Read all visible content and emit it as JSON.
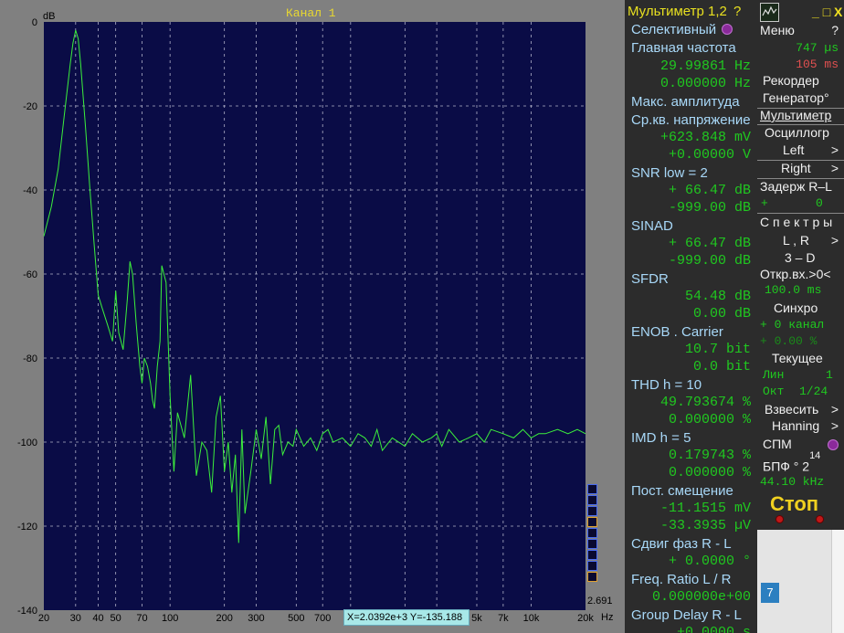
{
  "chart_data": {
    "type": "line",
    "title": "Канал 1",
    "xlabel": "Hz",
    "ylabel": "dB",
    "xscale": "log",
    "xlim": [
      20,
      20000
    ],
    "ylim": [
      -140,
      0
    ],
    "x_ticks": [
      "20",
      "30",
      "40",
      "50",
      "70",
      "100",
      "200",
      "300",
      "500",
      "700",
      "1k",
      "2k",
      "3k",
      "5k",
      "7k",
      "10k",
      "20k"
    ],
    "x_tick_values": [
      20,
      30,
      40,
      50,
      70,
      100,
      200,
      300,
      500,
      700,
      1000,
      2000,
      3000,
      5000,
      7000,
      10000,
      20000
    ],
    "y_ticks": [
      "0",
      "-20",
      "-40",
      "-60",
      "-80",
      "-100",
      "-120",
      "-140"
    ],
    "y_tick_values": [
      0,
      -20,
      -40,
      -60,
      -80,
      -100,
      -120,
      -140
    ],
    "grid": true,
    "series": [
      {
        "x": [
          20,
          22,
          24,
          26,
          28,
          29,
          30,
          31,
          32,
          34,
          36,
          38,
          40,
          42,
          45,
          48,
          50,
          52,
          55,
          58,
          60,
          62,
          65,
          68,
          70,
          72,
          75,
          78,
          80,
          82,
          85,
          88,
          90,
          95,
          100,
          105,
          110,
          120,
          130,
          140,
          150,
          160,
          170,
          180,
          190,
          200,
          210,
          220,
          230,
          240,
          250,
          260,
          280,
          300,
          320,
          340,
          360,
          380,
          400,
          420,
          450,
          480,
          500,
          550,
          600,
          650,
          700,
          750,
          800,
          900,
          1000,
          1100,
          1200,
          1300,
          1400,
          1500,
          1700,
          2000,
          2200,
          2500,
          2800,
          3000,
          3200,
          3500,
          4000,
          4500,
          5000,
          5500,
          6000,
          7000,
          8000,
          9000,
          10000,
          11000,
          12000,
          14000,
          16000,
          18000,
          20000
        ],
        "y": [
          -51,
          -44,
          -35,
          -22,
          -10,
          -5,
          -2,
          -4,
          -10,
          -25,
          -40,
          -53,
          -65,
          -68,
          -72,
          -76,
          -64,
          -74,
          -78,
          -66,
          -57,
          -60,
          -72,
          -82,
          -86,
          -80,
          -82,
          -86,
          -90,
          -92,
          -82,
          -76,
          -58,
          -62,
          -89,
          -107,
          -93,
          -99,
          -84,
          -108,
          -100,
          -102,
          -112,
          -94,
          -89,
          -107,
          -100,
          -112,
          -103,
          -124,
          -97,
          -117,
          -107,
          -97,
          -104,
          -94,
          -110,
          -97,
          -96,
          -103,
          -100,
          -101,
          -97,
          -101,
          -99,
          -102,
          -98,
          -97,
          -100,
          -99,
          -101,
          -98,
          -99,
          -101,
          -97,
          -102,
          -99,
          -101,
          -98,
          -100,
          -99,
          -98,
          -101,
          -97,
          -100,
          -99,
          -98,
          -100,
          -97,
          -98,
          -99,
          -97,
          -99,
          -98,
          -98,
          -97,
          -98,
          -97,
          -98
        ]
      }
    ]
  },
  "spectrum": {
    "cursor_readout": "X=2.0392e+3   Y=-135.188",
    "scale_value": "2.691"
  },
  "multimeter": {
    "title": "Мультиметр 1,2",
    "help": "?",
    "mode": "Селективный",
    "main_freq_label": "Главная частота",
    "main_freq_1": "29.99861  Hz",
    "main_freq_2": "0.000000  Hz",
    "max_amp_label": "Макс. амплитуда",
    "rms_label": "Ср.кв. напряжение",
    "rms_1": "+623.848 mV",
    "rms_2": "+0.00000  V",
    "snr_label": "SNR      low =   2",
    "snr_1": "+ 66.47 dB",
    "snr_2": "-999.00 dB",
    "sinad_label": "SINAD",
    "sinad_1": "+ 66.47 dB",
    "sinad_2": "-999.00 dB",
    "sfdr_label": "SFDR",
    "sfdr_1": "54.48 dB",
    "sfdr_2": "0.00 dB",
    "enob_label": "ENOB . Carrier",
    "enob_1": "10.7 bit",
    "enob_2": "0.0 bit",
    "thd_label": "THD       h =  10",
    "thd_1": "49.793674 %",
    "thd_2": "0.000000 %",
    "imd_label": "IMD       h =   5",
    "imd_1": "0.179743 %",
    "imd_2": "0.000000 %",
    "dc_label": "Пост. смещение",
    "dc_1": "-11.1515 mV",
    "dc_2": "-33.3935 µV",
    "phase_label": "Сдвиг фаз R - L",
    "phase_1": "+   0.0000 °",
    "freq_ratio_label": "Freq. Ratio  L / R",
    "freq_ratio_1": "0.000000e+00",
    "group_delay_label": "Group Delay R - L",
    "group_delay_1": "+0.0000  s"
  },
  "controls": {
    "minimize": "_",
    "maximize": "□",
    "close": "X",
    "menu": "Меню",
    "menu_help": "?",
    "time_1": "747  µs",
    "time_2": "105  ms",
    "recorder": "Рекордер",
    "generator": "Генератор°",
    "multimeter": "Мультиметр",
    "oscilloscope": "Осциллогр",
    "left": "Left",
    "right": "Right",
    "arrow": ">",
    "delay": "Задерж  R–L",
    "delay_sign": "+",
    "delay_value": "0",
    "spectra": "С п е к т р ы",
    "lr": "L , R",
    "three_d": "3 – D",
    "open_input": "Откр.вх.>0<",
    "open_input_value": "100.0 ms",
    "sync": "Синхро",
    "sync_channel": "+  0 канал",
    "sync_percent": "+  0.00 %",
    "current": "Текущее",
    "lin": "Лин",
    "lin_value": "1",
    "oct": "Окт",
    "oct_value": "1/24",
    "weigh": "Взвесить",
    "window": "Hanning",
    "spm": "СПМ",
    "fft": "БПФ ° 2",
    "fft_exp": "14",
    "sample_rate": "44.10 kHz",
    "stop": "Стоп",
    "badge": "7",
    "colors": {
      "green": "#20c820",
      "yellow": "#e8e020",
      "label_blue": "#a8d8f8",
      "panel": "#2c2c2c"
    }
  }
}
